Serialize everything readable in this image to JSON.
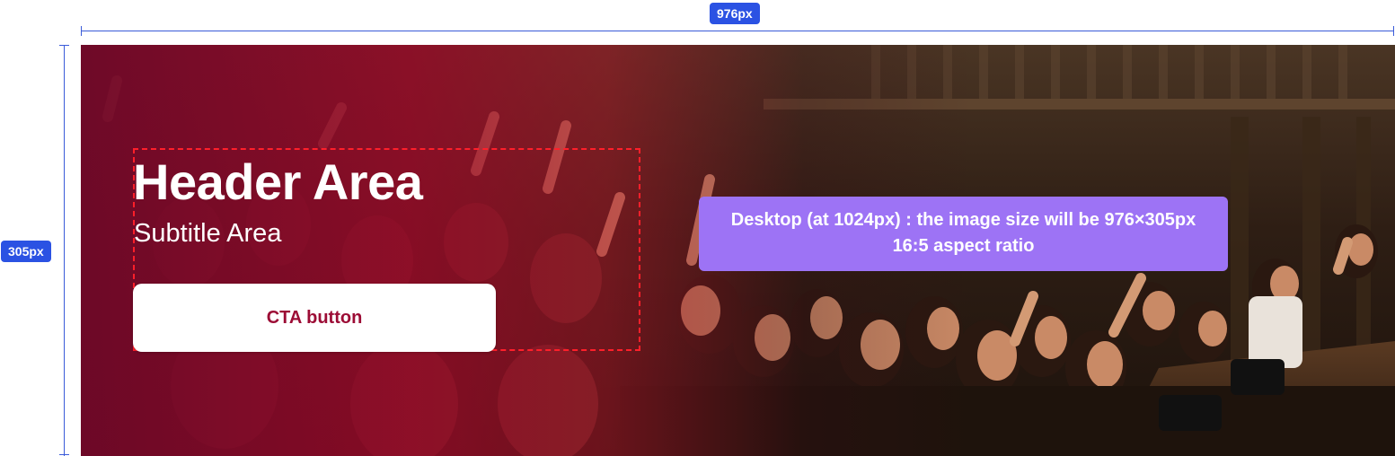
{
  "dimensions": {
    "width_label": "976px",
    "height_label": "305px"
  },
  "banner": {
    "header_title": "Header Area",
    "subtitle": "Subtitle Area",
    "cta_label": "CTA button",
    "background_image": "concert-crowd-photo",
    "gradient_color": "#9c0c35"
  },
  "note": {
    "line1": "Desktop (at 1024px) : the image size will be 976×305px",
    "line2": "16:5 aspect ratio",
    "background_color": "#9d73f5"
  },
  "colors": {
    "dimension_blue": "#2b52e3",
    "safe_area_dash": "#ff1f2a",
    "cta_text": "#9c0c35"
  }
}
